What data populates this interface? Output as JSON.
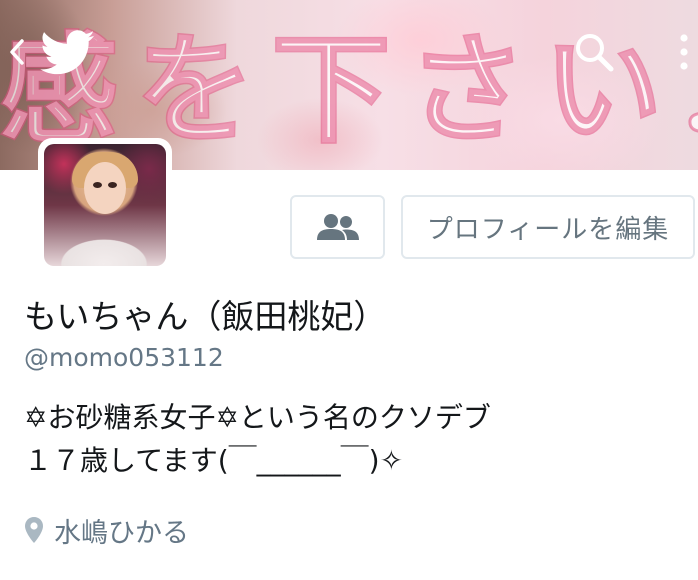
{
  "banner": {
    "overlay_text": "感を下さい♪",
    "colors": {
      "lettering_fill": "#ffffff",
      "lettering_stroke": "#e15082"
    }
  },
  "topbar": {
    "back_icon": "chevron-left-icon",
    "logo_icon": "twitter-bird-icon",
    "search_icon": "search-icon",
    "more_icon": "more-vertical-icon"
  },
  "profile": {
    "name": "もいちゃん（飯田桃妃）",
    "handle": "@momo053112",
    "bio_lines": [
      "✡お砂糖系女子✡という名のクソデブ",
      "１７歳してます(￣______￣)✧"
    ],
    "location": "水嶋ひかる"
  },
  "actions": {
    "follow_icon": "people-icon",
    "edit_profile_label": "プロフィールを編集"
  },
  "colors": {
    "text_primary": "#14171a",
    "text_secondary": "#657786",
    "button_border": "#e1e8ed",
    "icon_gray": "#66757f",
    "location_icon": "#aab8c2"
  }
}
